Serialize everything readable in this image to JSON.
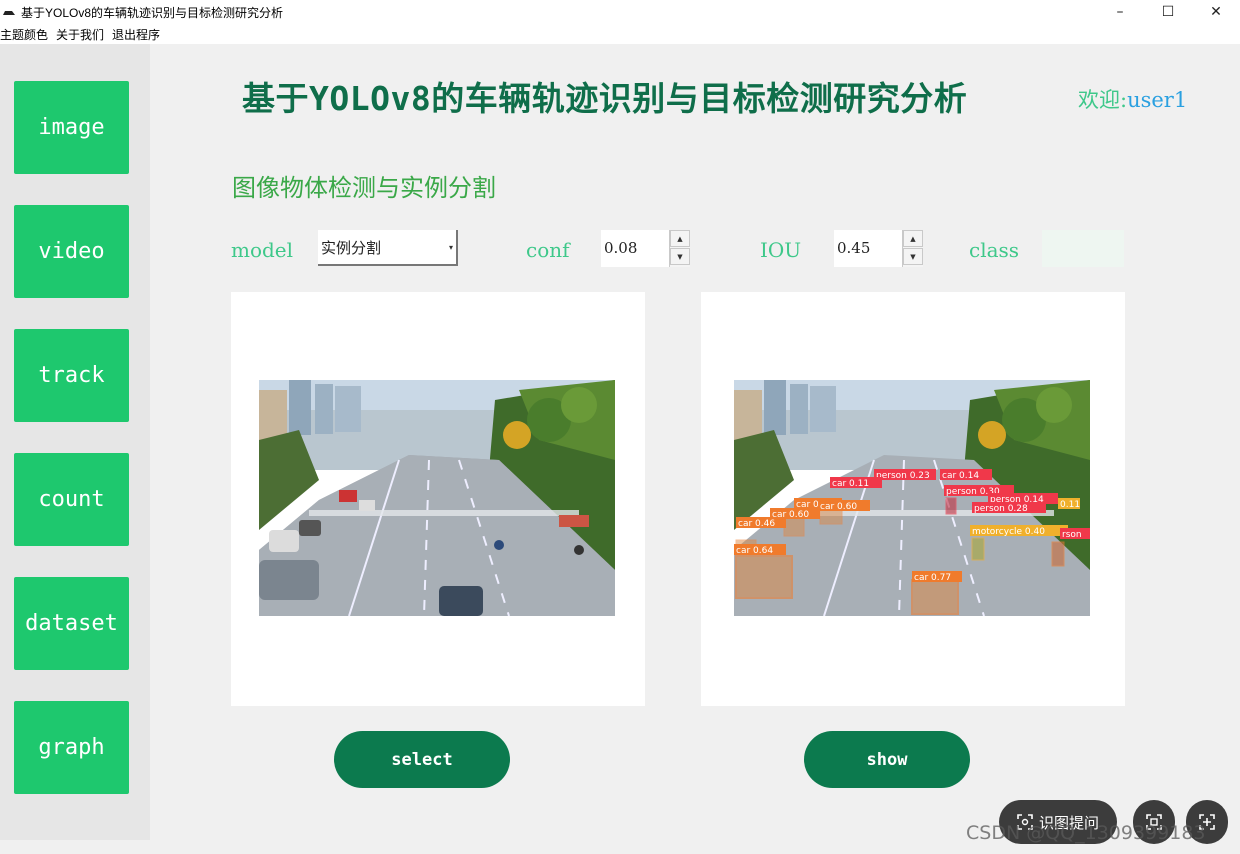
{
  "window": {
    "title": "基于YOLOv8的车辆轨迹识别与目标检测研究分析",
    "controls": {
      "minimize": "–",
      "maximize": "☐",
      "close": "✕"
    }
  },
  "menu": {
    "items": [
      "主题颜色",
      "关于我们",
      "退出程序"
    ]
  },
  "sidebar": {
    "items": [
      "image",
      "video",
      "track",
      "count",
      "dataset",
      "graph"
    ]
  },
  "header": {
    "title": "基于YOLOv8的车辆轨迹识别与目标检测研究分析",
    "welcome_label": "欢迎:",
    "username": "user1"
  },
  "section": {
    "title": "图像物体检测与实例分割"
  },
  "controls": {
    "model_label": "model",
    "model_value": "实例分割",
    "conf_label": "conf",
    "conf_value": "0.08",
    "iou_label": "IOU",
    "iou_value": "0.45",
    "class_label": "class",
    "class_value": ""
  },
  "detections": [
    "person 0.23",
    "car 0.14",
    "car 0.11",
    "person 0.30",
    "person 0.14",
    "0.11",
    "car 0.60",
    "car 0.60",
    "person 0.28",
    "car 0.46",
    "car 0.60",
    "motorcycle 0.40",
    "rson",
    "car 0.64",
    "car 0.77"
  ],
  "buttons": {
    "select": "select",
    "show": "show"
  },
  "overlay": {
    "tool_label": "识图提问",
    "watermark": "CSDN @QQ_1309399183"
  },
  "colors": {
    "accent": "#1ec86e",
    "primary_dark": "#0c7a4e",
    "title": "#0f6e4a"
  }
}
